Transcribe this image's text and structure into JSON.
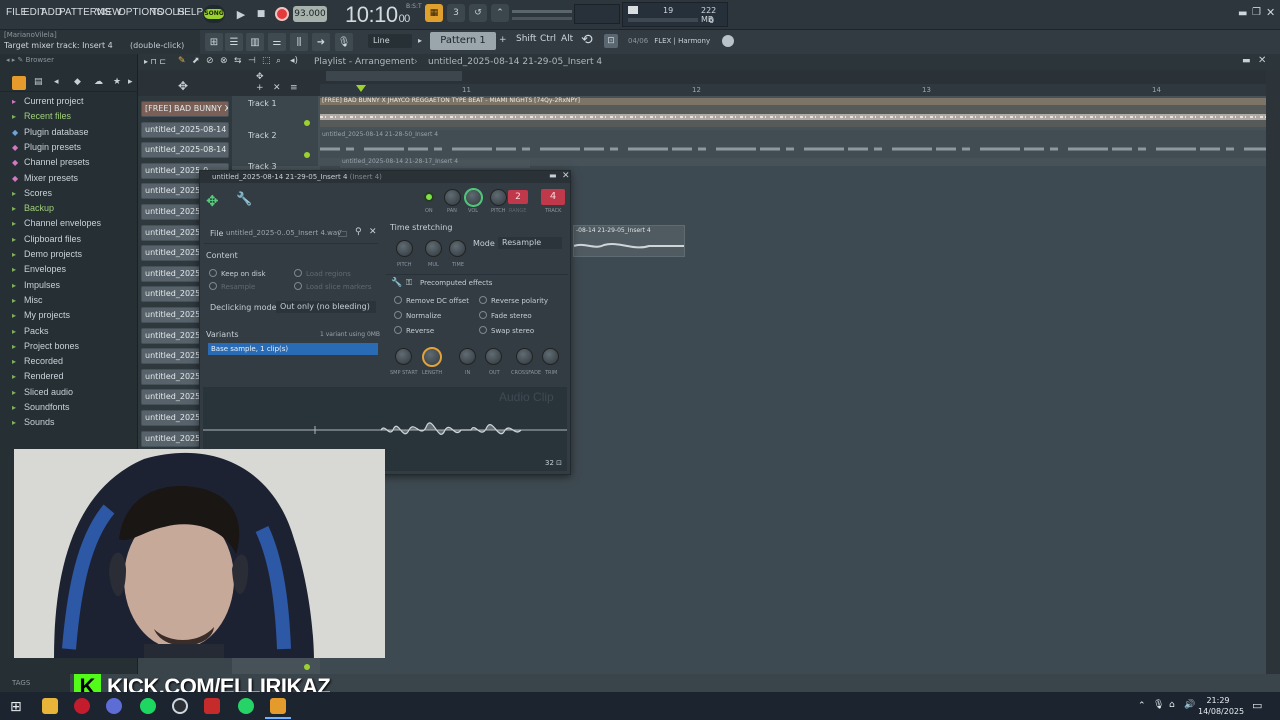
{
  "menu": [
    "FILE",
    "EDIT",
    "ADD",
    "PATTERNS",
    "VIEW",
    "OPTIONS",
    "TOOLS",
    "HELP"
  ],
  "transport": {
    "song_mode": "SONG",
    "tempo": "93.000",
    "time": "10:10",
    "time_sub": "00",
    "beat_label": "B:S:T"
  },
  "monitor": {
    "cpu": "19",
    "ram": "222 MB",
    "voices": "0"
  },
  "hint": {
    "user": "[MarianoVilela]",
    "target": "Target mixer track: Insert 4",
    "action": "(double-click)"
  },
  "toolbar": {
    "snap": "Line",
    "pattern": "Pattern 1",
    "shift": "Shift",
    "ctrl": "Ctrl",
    "alt": "Alt",
    "news_index": "04/06",
    "news_text": "FLEX | Harmony"
  },
  "browser": {
    "title": "Browser",
    "items": [
      {
        "label": "Current project",
        "icon": "folder-icon",
        "style": "pink"
      },
      {
        "label": "Recent files",
        "icon": "folder-icon",
        "style": "hl"
      },
      {
        "label": "Plugin database",
        "icon": "plug-icon",
        "style": "blue"
      },
      {
        "label": "Plugin presets",
        "icon": "plug-icon",
        "style": "pink"
      },
      {
        "label": "Channel presets",
        "icon": "plug-icon",
        "style": "pink"
      },
      {
        "label": "Mixer presets",
        "icon": "plug-icon",
        "style": "pink"
      },
      {
        "label": "Scores",
        "icon": "folder-icon",
        "style": "plain"
      },
      {
        "label": "Backup",
        "icon": "folder-icon",
        "style": "hl"
      },
      {
        "label": "Channel envelopes",
        "icon": "folder-icon",
        "style": "plain"
      },
      {
        "label": "Clipboard files",
        "icon": "folder-icon",
        "style": "plain"
      },
      {
        "label": "Demo projects",
        "icon": "folder-icon",
        "style": "plain"
      },
      {
        "label": "Envelopes",
        "icon": "folder-icon",
        "style": "plain"
      },
      {
        "label": "Impulses",
        "icon": "folder-icon",
        "style": "plain"
      },
      {
        "label": "Misc",
        "icon": "folder-icon",
        "style": "plain"
      },
      {
        "label": "My projects",
        "icon": "folder-icon",
        "style": "plain"
      },
      {
        "label": "Packs",
        "icon": "folder-icon",
        "style": "plain"
      },
      {
        "label": "Project bones",
        "icon": "folder-icon",
        "style": "plain"
      },
      {
        "label": "Recorded",
        "icon": "folder-icon",
        "style": "plain"
      },
      {
        "label": "Rendered",
        "icon": "folder-icon",
        "style": "plain"
      },
      {
        "label": "Sliced audio",
        "icon": "folder-icon",
        "style": "plain"
      },
      {
        "label": "Soundfonts",
        "icon": "folder-icon",
        "style": "plain"
      },
      {
        "label": "Sounds",
        "icon": "folder-icon",
        "style": "plain"
      }
    ]
  },
  "clips": [
    "[FREE] BAD BUNNY X...",
    "untitled_2025-08-14 21-...",
    "untitled_2025-08-14 21-...",
    "untitled_2025-0",
    "untitled_2025-0",
    "untitled_2025-0",
    "untitled_2025-0",
    "untitled_2025-0",
    "untitled_2025-0",
    "untitled_2025-0",
    "untitled_2025-0",
    "untitled_2025-0",
    "untitled_2025-0",
    "untitled_2025-0",
    "untitled_2025-0",
    "untitled_2025-0",
    "untitled_2025-0"
  ],
  "playlist": {
    "title": "Playlist - Arrangement",
    "pattern": "untitled_2025-08-14 21-29-05_Insert 4",
    "ruler": [
      "11",
      "12",
      "13",
      "14"
    ],
    "tracks": [
      "Track 1",
      "Track 2",
      "Track 3"
    ],
    "track1_clip": "[FREE] BAD BUNNY X JHAYCO REGGAETON TYPE BEAT - MIAMI NIGHTS [74Qy-2RxNPY]",
    "track2_clip": "untitled_2025-08-14 21-28-50_Insert 4",
    "track3_clip": "untitled_2025-08-14 21-28-17_Insert 4",
    "side_clip": "-08-14 21-29-05_Insert 4"
  },
  "dialog": {
    "title": "untitled_2025-08-14 21-29-05_Insert 4",
    "subtitle": "(Insert 4)",
    "knobs": [
      "ON",
      "PAN",
      "VOL",
      "PITCH",
      "RANGE",
      "TRACK"
    ],
    "range_value": "2",
    "track_value": "4",
    "file_label": "File",
    "file_name": "untitled_2025-0..05_Insert 4.wav",
    "content_label": "Content",
    "keep_on_disk": "Keep on disk",
    "resample": "Resample",
    "load_regions": "Load regions",
    "load_slice": "Load slice markers",
    "declick_label": "Declicking mode",
    "declick_value": "Out only (no bleeding)",
    "variants_label": "Variants",
    "variants_info": "1 variant using 0MB",
    "variant_selected": "Base sample, 1 clip(s)",
    "ts_label": "Time stretching",
    "ts_knobs": [
      "PITCH",
      "MUL",
      "TIME"
    ],
    "mode_label": "Mode",
    "mode_value": "Resample",
    "pre_label": "Precomputed effects",
    "effects_left": [
      "Remove DC offset",
      "Normalize",
      "Reverse"
    ],
    "effects_right": [
      "Reverse polarity",
      "Fade stereo",
      "Swap stereo"
    ],
    "pre_knobs": [
      "SMP START",
      "LENGTH",
      "IN",
      "OUT",
      "CROSSFADE",
      "TRIM"
    ],
    "watermark": "Audio Clip",
    "zoom": "32"
  },
  "overlay": {
    "kick_letter": "K",
    "kick_text": "KICK.COM/ELLIRIKAZ"
  },
  "tags": "TAGS",
  "taskbar": {
    "time": "21:29",
    "date": "14/08/2025"
  },
  "colors": {
    "accent": "#9bd22f",
    "record": "#e33b3b",
    "selection": "#2a6bb6",
    "kick": "#53fc18",
    "track_red": "#c0394b"
  }
}
